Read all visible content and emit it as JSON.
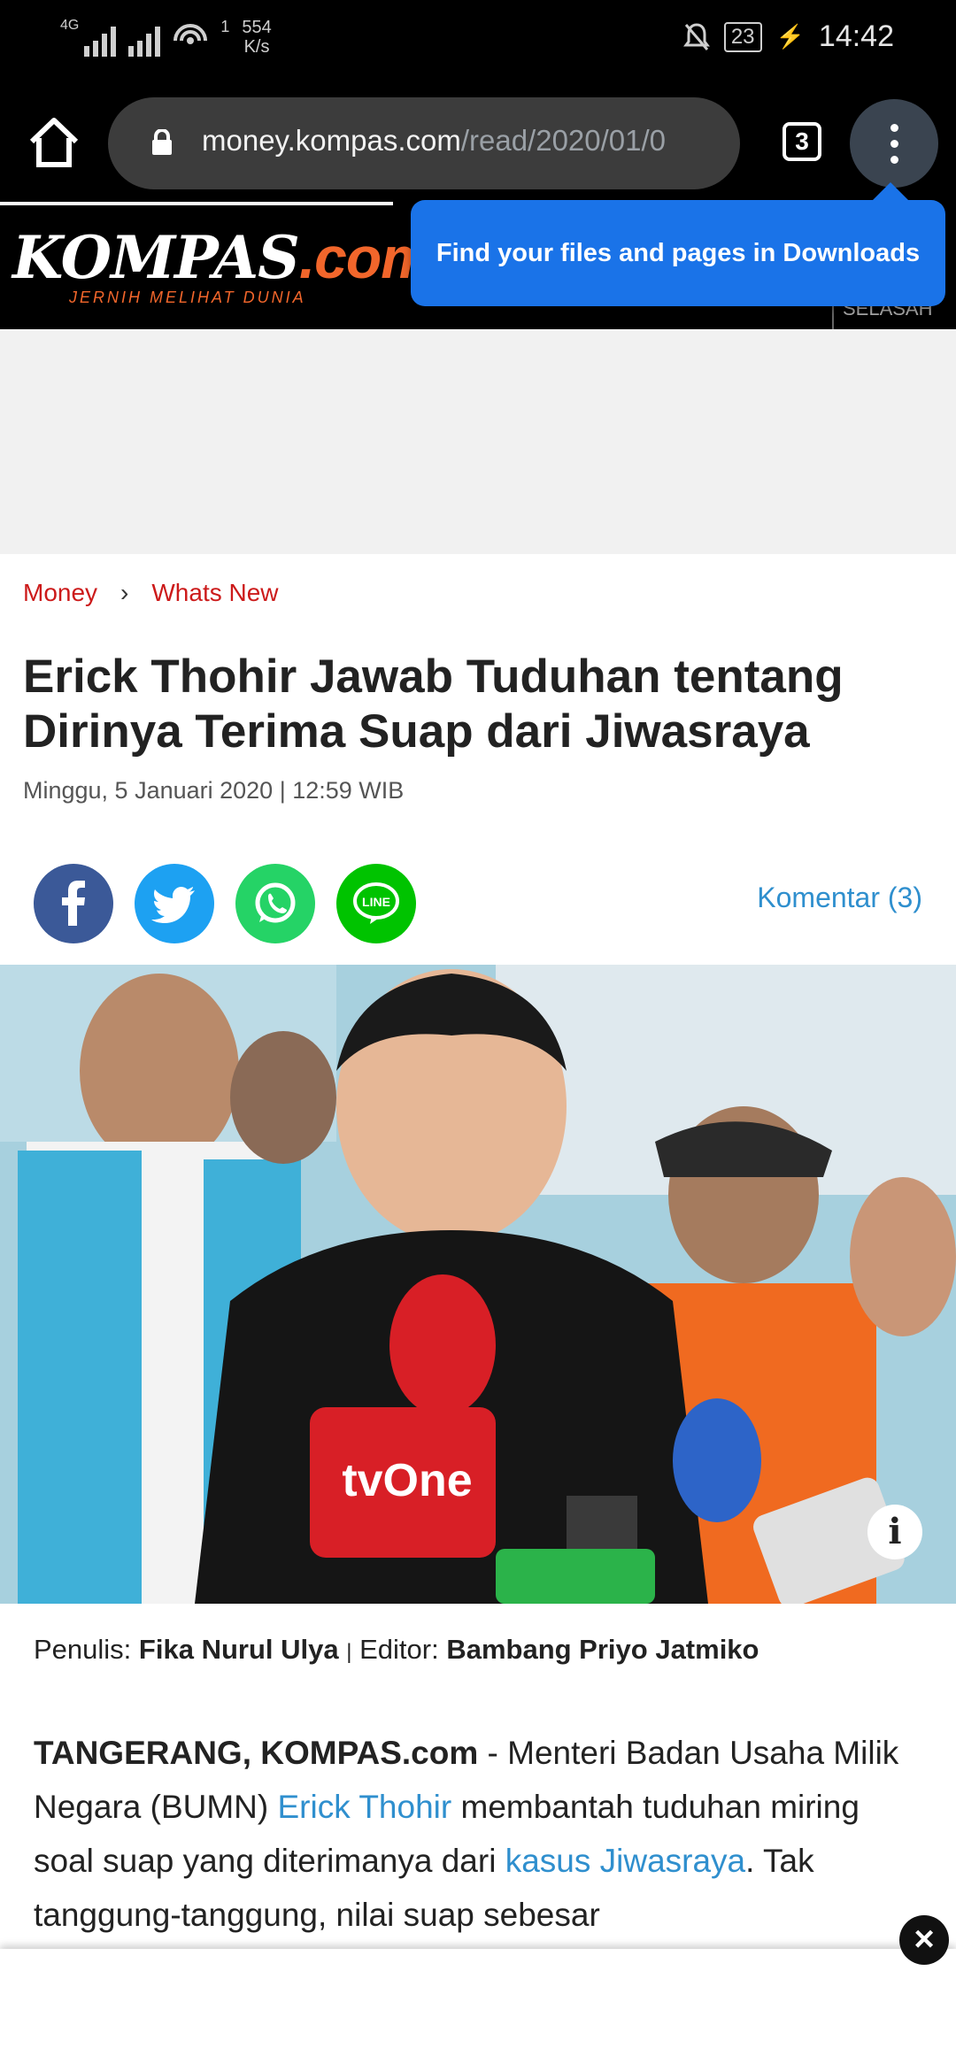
{
  "status_bar": {
    "network_tag": "4G",
    "sim_superscript": "1",
    "speed_value": "554",
    "speed_unit": "K/s",
    "battery": "23",
    "time": "14:42"
  },
  "browser": {
    "url_host": "money.kompas.com",
    "url_path": "/read/2020/01/0",
    "tab_count": "3",
    "tooltip": "Find your files and pages in Downloads"
  },
  "site": {
    "logo_main": "KOMPAS",
    "logo_suffix": ".com",
    "tagline": "JERNIH MELIHAT DUNIA",
    "header_cut_text": "SELASAH"
  },
  "breadcrumb": {
    "items": [
      "Money",
      "Whats New"
    ],
    "separator": "›"
  },
  "article": {
    "title": "Erick Thohir Jawab Tuduhan tentang Dirinya Terima Suap dari Jiwasraya",
    "date": "Minggu, 5 Januari 2020 | 12:59 WIB",
    "comments": "Komentar (3)",
    "writer_label": "Penulis:",
    "writer": "Fika Nurul Ulya",
    "byline_sep": "|",
    "editor_label": "Editor:",
    "editor": "Bambang Priyo Jatmiko",
    "photo_mic_brand": "tvOne",
    "body": {
      "dateline": "TANGERANG, KOMPAS.com",
      "t1": " - Menteri Badan Usaha Milik Negara (BUMN) ",
      "link1": "Erick Thohir",
      "t2": " membantah tuduhan miring soal suap yang diterimanya dari ",
      "link2": "kasus Jiwasraya",
      "t3": ". Tak tanggung-tanggung, nilai suap sebesar"
    }
  },
  "icons": {
    "home": "home-icon",
    "lock": "lock-icon",
    "menu": "more-vert-icon",
    "share": [
      "facebook-icon",
      "twitter-icon",
      "whatsapp-icon",
      "line-icon"
    ],
    "info": "info-icon",
    "close": "close-icon"
  },
  "colors": {
    "accent_blue": "#1a73e8",
    "link_blue": "#2f8fce",
    "breadcrumb_red": "#cc1a1a",
    "kompas_orange": "#f2662b"
  }
}
